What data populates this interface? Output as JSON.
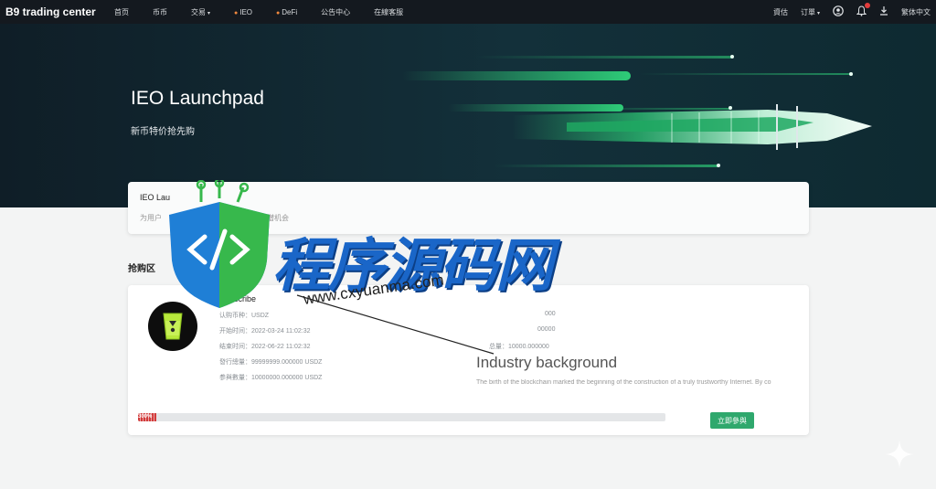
{
  "nav": {
    "brand": "B9 trading center",
    "links": [
      "首页",
      "币币",
      "交易",
      "IEO",
      "DeFi",
      "公告中心",
      "在線客服"
    ],
    "right": {
      "assets": "資估",
      "orders": "订單",
      "lang": "繁体中文"
    }
  },
  "hero": {
    "title": "IEO Launchpad",
    "subtitle": "新币特价抢先购"
  },
  "info_card": {
    "title": "IEO Lau",
    "desc": "为用户",
    "desc_tail": "潜机会"
  },
  "section": {
    "title": "抢购区"
  },
  "project": {
    "subscribe_label": "Subscribe",
    "details": [
      "认购币种：USDZ",
      "开始时间：2022-03-24 11:02:32",
      "结束时间：2022-06-22 11:02:32",
      "發行總量：99999999.000000 USDZ",
      "参與數量：10000000.000000 USDZ"
    ],
    "right_details": [
      "000",
      "00000",
      "总量：10000.000000"
    ],
    "industry_title": "Industry background",
    "industry_text": "The birth of the blockchain marked the beginning of the construction of a truly trustworthy Internet. By co",
    "progress_pct": 0.035,
    "progress_label": "300%",
    "buy_label": "立即參與"
  },
  "watermark": {
    "text": "程序源码网",
    "url": "www.cxyuanma.com"
  },
  "colors": {
    "nav_bg": "#14191f",
    "hero_bg": "#13303a",
    "accent_green": "#2fa86d",
    "progress_red": "#d23a3a",
    "watermark_blue": "#1a66c8"
  }
}
